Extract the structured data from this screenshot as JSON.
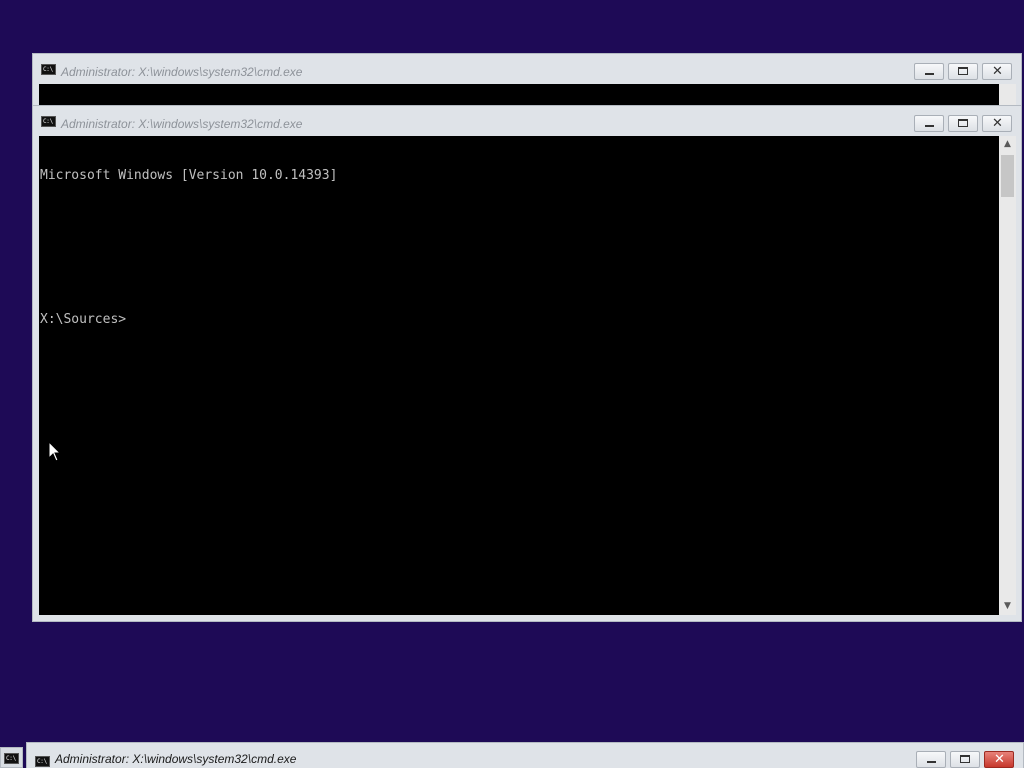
{
  "desktop": {
    "background_color": "#1e0a56"
  },
  "windows": {
    "back": {
      "title": "Administrator: X:\\windows\\system32\\cmd.exe",
      "partial_line": "  :    :   : ."
    },
    "front": {
      "title": "Administrator: X:\\windows\\system32\\cmd.exe",
      "lines": [
        "Microsoft Windows [Version 10.0.14393]",
        "",
        "",
        "X:\\Sources>"
      ]
    },
    "bottom": {
      "title": "Administrator: X:\\windows\\system32\\cmd.exe"
    }
  },
  "icons": {
    "console_icon": "console-icon",
    "minimize": "minimize-icon",
    "maximize": "maximize-icon",
    "close": "close-icon",
    "scroll_up": "up-arrow-icon",
    "scroll_down": "down-arrow-icon",
    "cursor": "mouse-pointer-icon"
  },
  "glyphs": {
    "close": "✕",
    "scroll_up": "▲",
    "scroll_down": "▼"
  }
}
